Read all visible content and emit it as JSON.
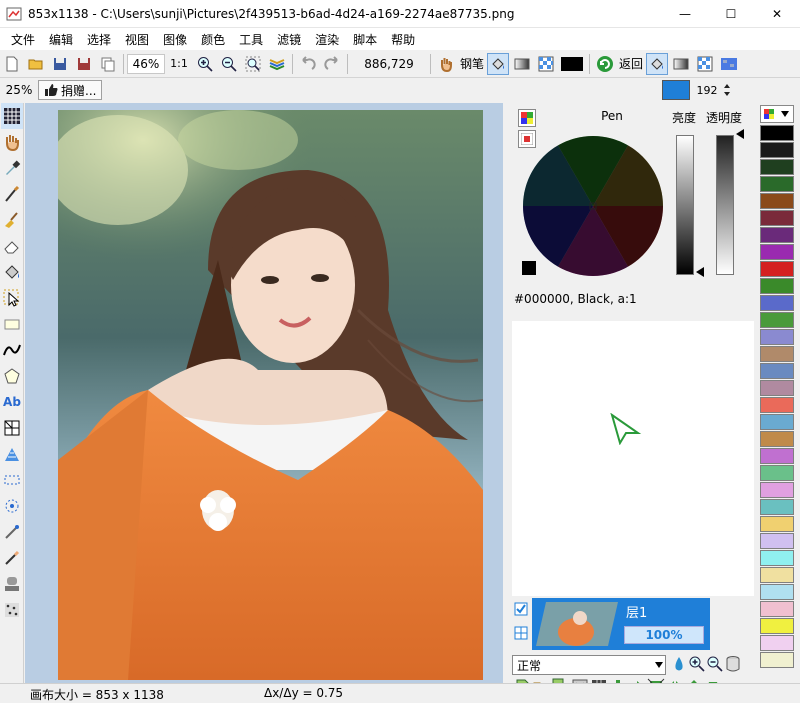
{
  "window": {
    "title": "853x1138 - C:\\Users\\sunji\\Pictures\\2f439513-b6ad-4d24-a169-2274ae87735.png",
    "minimize": "—",
    "maximize": "☐",
    "close": "✕"
  },
  "menu": [
    "文件",
    "编辑",
    "选择",
    "视图",
    "图像",
    "颜色",
    "工具",
    "滤镜",
    "渲染",
    "脚本",
    "帮助"
  ],
  "toolbar": {
    "zoom": "46%",
    "ratio": "1:1",
    "coords": "886,729",
    "pen_label": "钢笔",
    "back_label": "返回",
    "opacity_value": "192"
  },
  "toolbar2": {
    "zoom": "25%",
    "donate_label": "捐赠..."
  },
  "color_panel": {
    "title": "Pen",
    "brightness_label": "亮度",
    "opacity_label": "透明度",
    "color_info": "#000000, Black, a:1"
  },
  "layer": {
    "name": "层1",
    "opacity": "100%",
    "blend_mode": "正常"
  },
  "status": {
    "canvas_size": "画布大小 = 853 x 1138",
    "delta": "Δx/Δy = 0.75"
  },
  "palette_colors": [
    "#000000",
    "#1a1a1a",
    "#1f3f1f",
    "#2a6a2a",
    "#8a4a1a",
    "#7a2a3a",
    "#6a2a7a",
    "#9a2ab0",
    "#d42020",
    "#3a8a2a",
    "#5a6aca",
    "#4a9a3a",
    "#8a8ad0",
    "#b08a6a",
    "#6a8ac0",
    "#b08aa0",
    "#ea6a5a",
    "#6aaad0",
    "#c08a4a",
    "#c070d0",
    "#6ac08a",
    "#e0a0e0",
    "#6ac0c0",
    "#f0d070",
    "#d0c0f0",
    "#90f0f0",
    "#f0e0a0",
    "#b0e0f0",
    "#f0c0d0",
    "#f0f040",
    "#f0d0f0",
    "#f0f0d0"
  ],
  "accent": "#1f7fd8"
}
